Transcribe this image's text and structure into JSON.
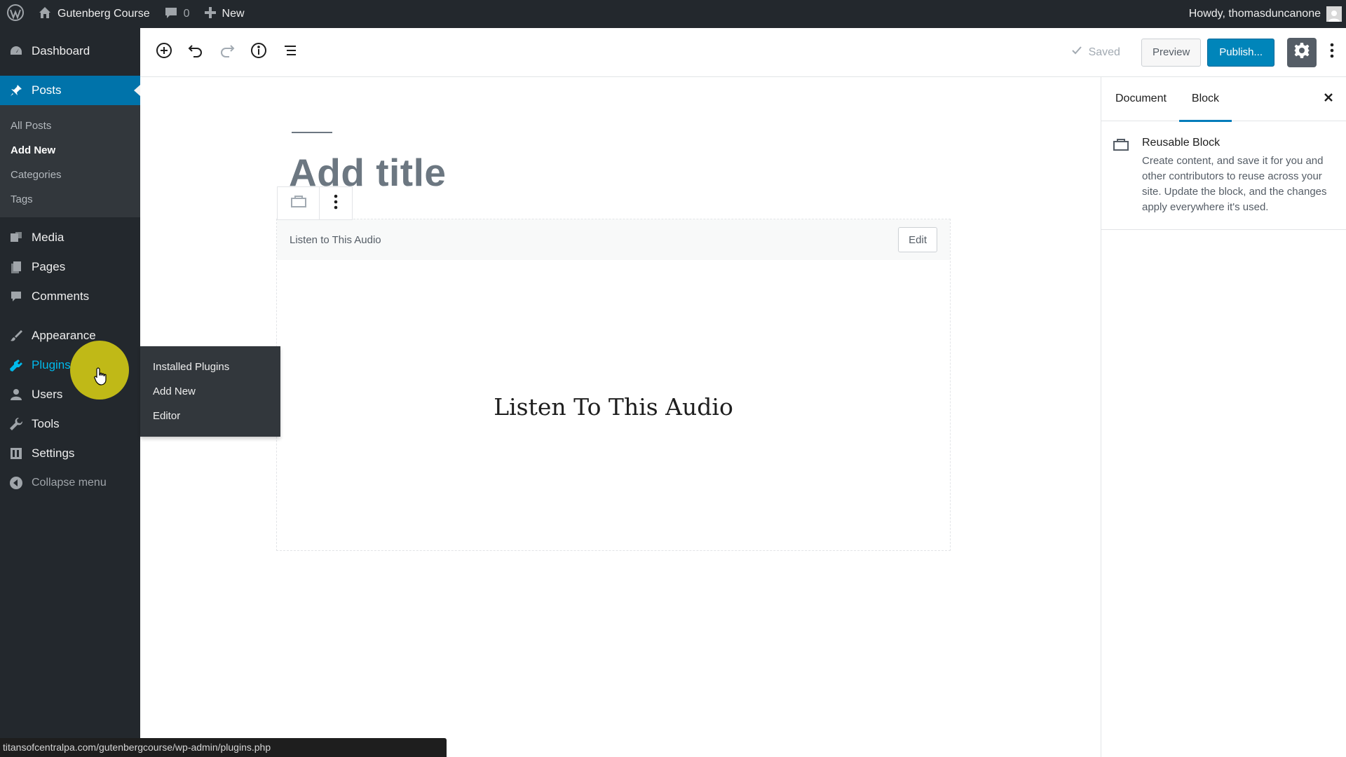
{
  "adminbar": {
    "site_name": "Gutenberg Course",
    "comments_count": "0",
    "new_label": "New",
    "howdy": "Howdy, thomasduncanone"
  },
  "sidebar": {
    "dashboard": "Dashboard",
    "posts": "Posts",
    "posts_submenu": [
      "All Posts",
      "Add New",
      "Categories",
      "Tags"
    ],
    "media": "Media",
    "pages": "Pages",
    "comments": "Comments",
    "appearance": "Appearance",
    "plugins": "Plugins",
    "users": "Users",
    "tools": "Tools",
    "settings": "Settings",
    "collapse": "Collapse menu"
  },
  "plugins_flyout": [
    "Installed Plugins",
    "Add New",
    "Editor"
  ],
  "header": {
    "saved": "Saved",
    "preview": "Preview",
    "publish": "Publish..."
  },
  "editor": {
    "title_placeholder": "Add title",
    "reusable_block_name": "Listen to This Audio",
    "edit_label": "Edit",
    "block_heading": "Listen To This Audio"
  },
  "inspector": {
    "tabs": [
      "Document",
      "Block"
    ],
    "active_tab": "Block",
    "block_title": "Reusable Block",
    "block_description": "Create content, and save it for you and other contributors to reuse across your site. Update the block, and the changes apply everywhere it's used."
  },
  "status_url": "titansofcentralpa.com/gutenbergcourse/wp-admin/plugins.php",
  "colors": {
    "admin_dark": "#23282d",
    "accent": "#0073aa",
    "publish": "#0085ba",
    "highlight": "#dcd214"
  },
  "icons": [
    "wordpress-icon",
    "home-icon",
    "comment-icon",
    "plus-icon",
    "dashboard-icon",
    "pin-icon",
    "media-icon",
    "pages-icon",
    "comments-icon",
    "brush-icon",
    "plugin-icon",
    "user-icon",
    "wrench-icon",
    "settings-icon",
    "collapse-icon",
    "add-block-icon",
    "undo-icon",
    "redo-icon",
    "info-icon",
    "outline-icon",
    "check-icon",
    "gear-icon",
    "kebab-icon",
    "reusable-block-icon",
    "close-icon",
    "hand-cursor-icon"
  ]
}
